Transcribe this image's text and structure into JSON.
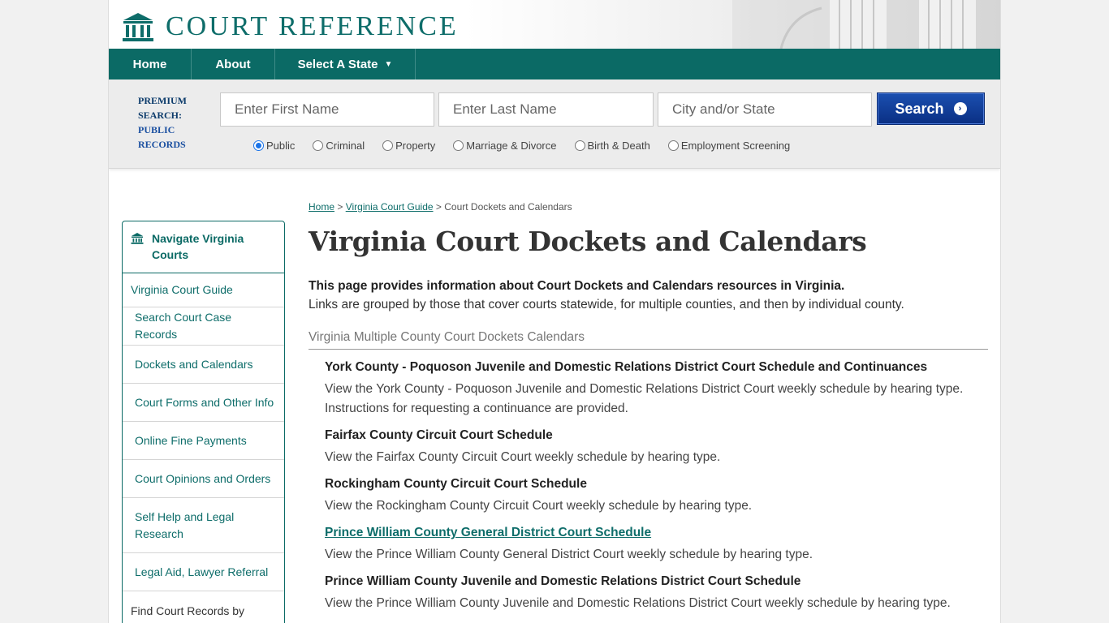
{
  "brand": {
    "name": "COURT REFERENCE",
    "logo_icon": "courthouse-icon"
  },
  "nav": [
    {
      "label": "Home"
    },
    {
      "label": "About"
    },
    {
      "label": "Select A State"
    }
  ],
  "search": {
    "premium_line1": "PREMIUM",
    "premium_line2": "SEARCH:",
    "premium_line3": "PUBLIC",
    "premium_line4": "RECORDS",
    "first_name_placeholder": "Enter First Name",
    "last_name_placeholder": "Enter Last Name",
    "city_state_placeholder": "City and/or State",
    "button_label": "Search",
    "options": [
      {
        "label": "Public",
        "selected": true
      },
      {
        "label": "Criminal",
        "selected": false
      },
      {
        "label": "Property",
        "selected": false
      },
      {
        "label": "Marriage & Divorce",
        "selected": false
      },
      {
        "label": "Birth & Death",
        "selected": false
      },
      {
        "label": "Employment Screening",
        "selected": false
      }
    ]
  },
  "sidebar": {
    "title": "Navigate Virginia Courts",
    "items": [
      {
        "label": "Virginia Court Guide"
      },
      {
        "label": "Search Court Case Records"
      },
      {
        "label": "Dockets and Calendars"
      },
      {
        "label": "Court Forms and Other Info"
      },
      {
        "label": "Online Fine Payments"
      },
      {
        "label": "Court Opinions and Orders"
      },
      {
        "label": "Self Help and Legal Research"
      },
      {
        "label": "Legal Aid, Lawyer Referral"
      },
      {
        "label": "Find Court Records by Virginia County"
      }
    ]
  },
  "breadcrumb": {
    "home": "Home",
    "sep1": " > ",
    "guide": "Virginia Court Guide",
    "sep2": " > ",
    "current": "Court Dockets and Calendars"
  },
  "main": {
    "title": "Virginia Court Dockets and Calendars",
    "intro_bold": "This page provides information about Court Dockets and Calendars resources in Virginia.",
    "intro_rest": "Links are grouped by those that cover courts statewide, for multiple counties, and then by individual county.",
    "section_title": "Virginia Multiple County Court Dockets Calendars",
    "entries": [
      {
        "title": "York County - Poquoson Juvenile and Domestic Relations District Court Schedule and Continuances",
        "desc": "View the York County - Poquoson Juvenile and Domestic Relations District Court weekly schedule by hearing type. Instructions for requesting a continuance are provided."
      },
      {
        "title": "Fairfax County Circuit Court Schedule",
        "desc": "View the Fairfax County Circuit Court weekly schedule by hearing type."
      },
      {
        "title": "Rockingham County Circuit Court Schedule",
        "desc": "View the Rockingham County Circuit Court weekly schedule by hearing type."
      },
      {
        "title": "Prince William County General District Court Schedule",
        "desc": "View the Prince William County General District Court weekly schedule by hearing type."
      },
      {
        "title": "Prince William County Juvenile and Domestic Relations District Court Schedule",
        "desc": "View the Prince William County Juvenile and Domestic Relations District Court weekly schedule by hearing type."
      }
    ]
  },
  "colors": {
    "teal": "#0b6a65",
    "search_blue": "#0a2f83",
    "link": "#0e6d6a"
  }
}
